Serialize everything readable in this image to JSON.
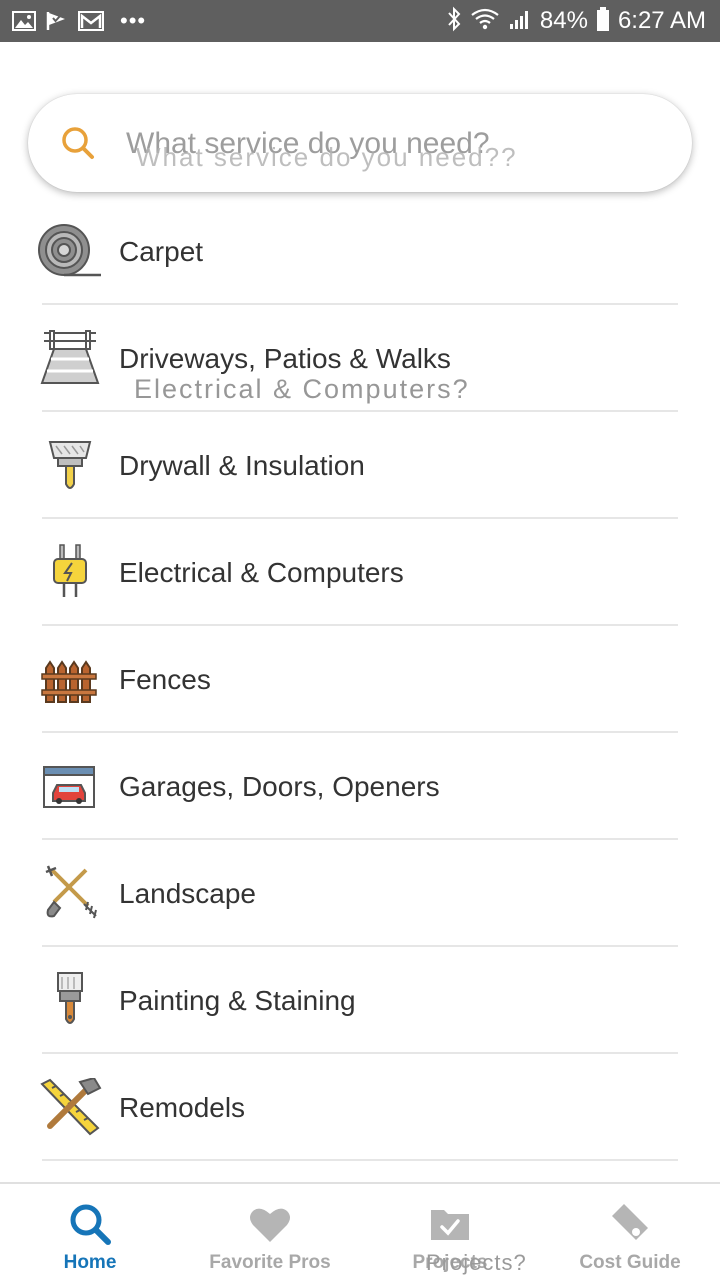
{
  "status_bar": {
    "battery": "84%",
    "time": "6:27 AM",
    "icons": [
      "image-icon",
      "check-flag-icon",
      "gmail-icon",
      "more-dots-icon",
      "bluetooth-icon",
      "wifi-icon",
      "signal-icon",
      "battery-icon"
    ]
  },
  "search": {
    "placeholder": "What service do you need?",
    "overlay_text": "What service do you need??"
  },
  "categories": [
    {
      "label": "Carpet",
      "icon": "carpet-roll-icon"
    },
    {
      "label": "Driveways, Patios & Walks",
      "icon": "driveway-icon"
    },
    {
      "label": "Drywall & Insulation",
      "icon": "putty-knife-icon"
    },
    {
      "label": "Electrical & Computers",
      "icon": "electric-plug-icon"
    },
    {
      "label": "Fences",
      "icon": "fence-icon"
    },
    {
      "label": "Garages, Doors, Openers",
      "icon": "garage-icon"
    },
    {
      "label": "Landscape",
      "icon": "shovel-rake-icon"
    },
    {
      "label": "Painting & Staining",
      "icon": "paintbrush-icon"
    },
    {
      "label": "Remodels",
      "icon": "hammer-ruler-icon"
    }
  ],
  "overlay_electrical": "Electrical & Computers?",
  "bottom_nav": {
    "tabs": [
      {
        "label": "Home",
        "icon": "search-icon",
        "active": true
      },
      {
        "label": "Favorite Pros",
        "icon": "heart-icon",
        "active": false
      },
      {
        "label": "Projects",
        "icon": "folder-check-icon",
        "active": false
      },
      {
        "label": "Cost Guide",
        "icon": "price-tag-icon",
        "active": false
      }
    ],
    "overlay_projects": "Projects?"
  },
  "colors": {
    "accent": "#1675b8",
    "search_icon": "#e8a13a",
    "status_bar": "#5f5f5f",
    "inactive_tab": "#a8a8a8"
  }
}
